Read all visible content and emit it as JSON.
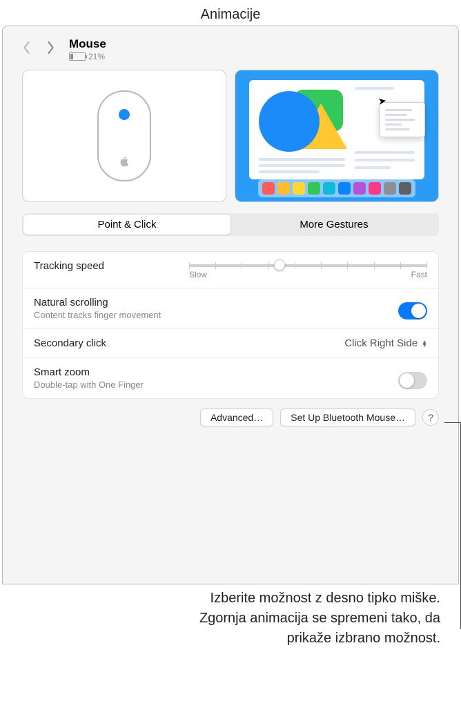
{
  "annotations": {
    "top": "Animacije",
    "bottom_l1": "Izberite možnost z desno tipko miške.",
    "bottom_l2": "Zgornja animacija se spremeni tako, da",
    "bottom_l3": "prikaže izbrano možnost."
  },
  "header": {
    "title": "Mouse",
    "battery_percent": "21%"
  },
  "tabs": {
    "point_click": "Point & Click",
    "more_gestures": "More Gestures"
  },
  "settings": {
    "tracking": {
      "label": "Tracking speed",
      "slow": "Slow",
      "fast": "Fast"
    },
    "natural": {
      "label": "Natural scrolling",
      "sub": "Content tracks finger movement",
      "on": true
    },
    "secondary": {
      "label": "Secondary click",
      "value": "Click Right Side"
    },
    "smart": {
      "label": "Smart zoom",
      "sub": "Double-tap with One Finger",
      "on": false
    }
  },
  "buttons": {
    "advanced": "Advanced…",
    "bluetooth": "Set Up Bluetooth Mouse…",
    "help": "?"
  },
  "dock_colors": [
    "#ff5b57",
    "#ffbd2e",
    "#ffd633",
    "#33c758",
    "#13b9dc",
    "#0a84ff",
    "#b452da",
    "#ff3988",
    "#8e8e93",
    "#5f5f62"
  ]
}
